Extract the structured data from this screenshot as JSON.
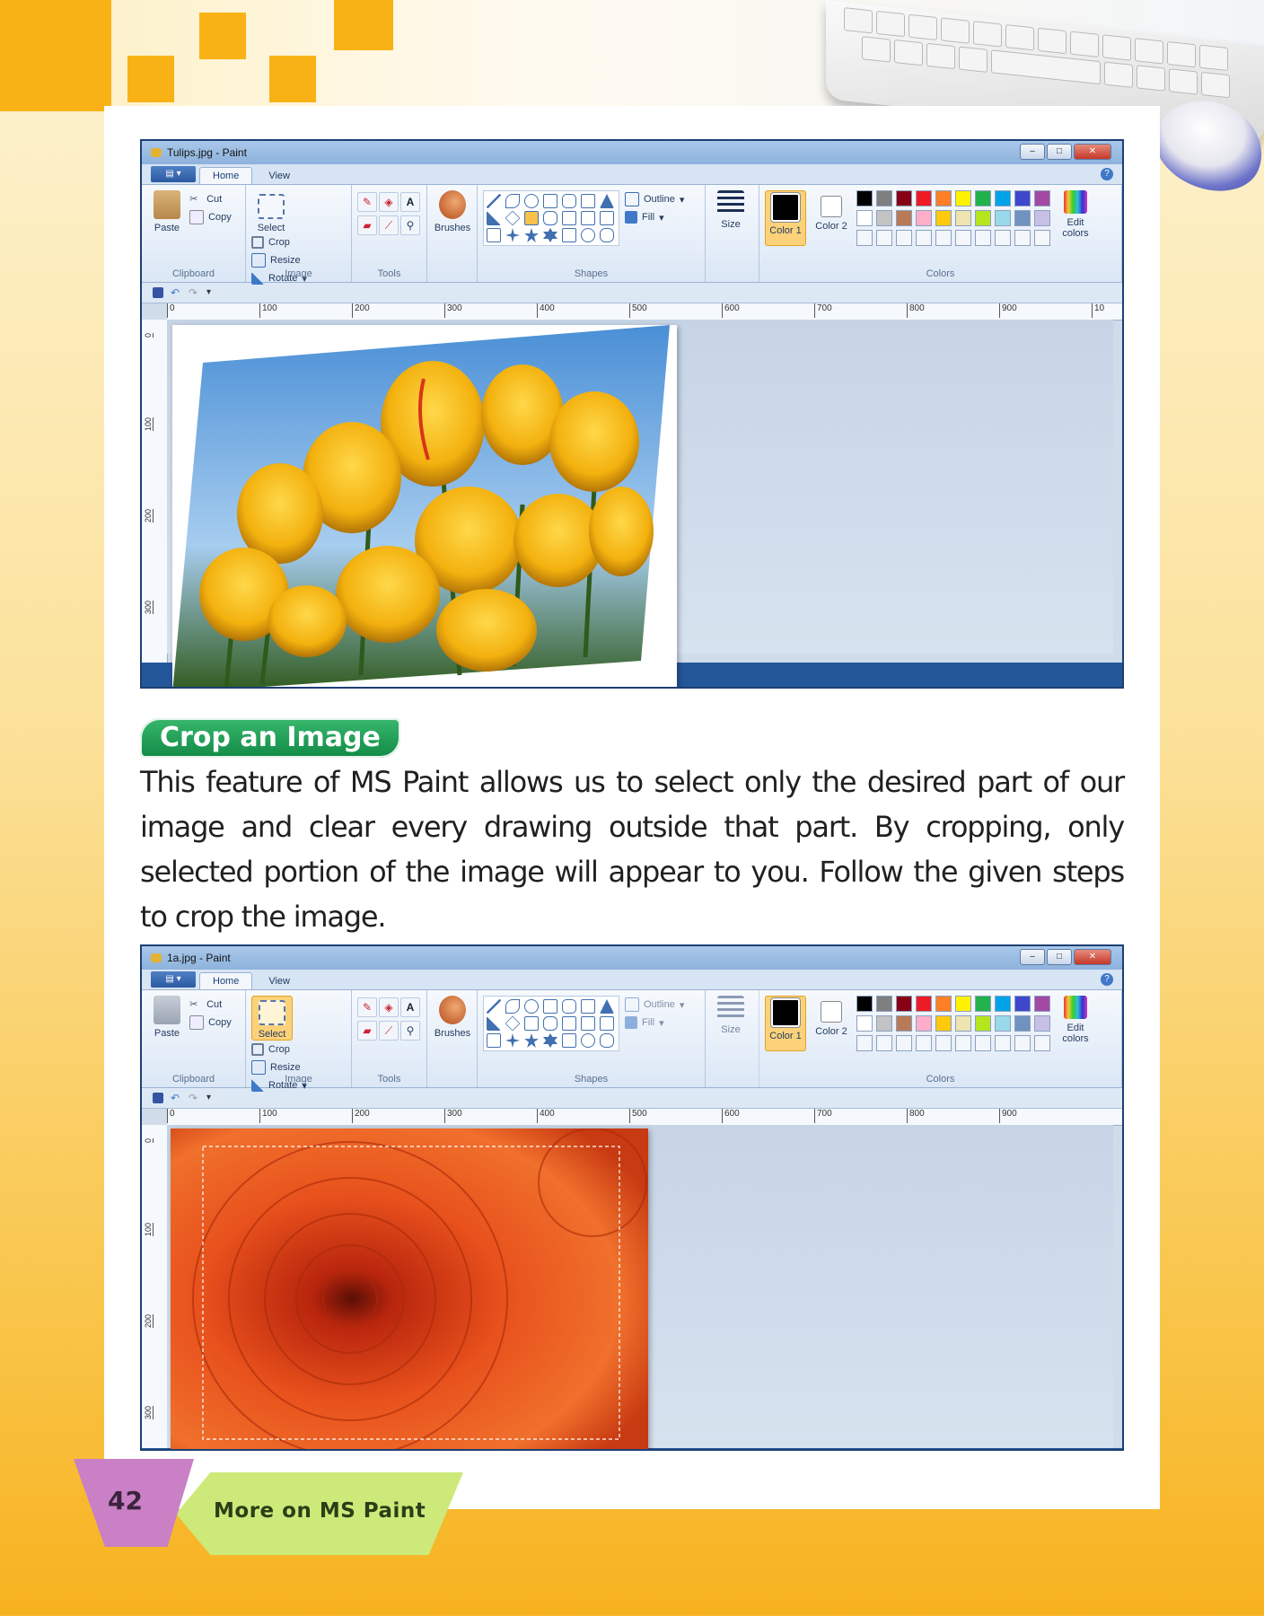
{
  "window1": {
    "title": "Tulips.jpg - Paint",
    "tabs": [
      "Home",
      "View"
    ],
    "active_tab": "Home",
    "groups": {
      "clipboard": {
        "label": "Clipboard",
        "paste": "Paste",
        "cut": "Cut",
        "copy": "Copy"
      },
      "image": {
        "label": "Image",
        "select": "Select",
        "crop": "Crop",
        "resize": "Resize",
        "rotate": "Rotate"
      },
      "tools": {
        "label": "Tools"
      },
      "brushes": {
        "label": "Brushes"
      },
      "shapes": {
        "label": "Shapes",
        "outline": "Outline",
        "fill": "Fill"
      },
      "size": {
        "label": "Size"
      },
      "colors": {
        "label": "Colors",
        "color1": "Color 1",
        "color2": "Color 2",
        "edit": "Edit colors"
      }
    },
    "ruler_h": [
      "0",
      "100",
      "200",
      "300",
      "400",
      "500",
      "600",
      "700",
      "800",
      "900",
      "10"
    ],
    "ruler_v": [
      "0",
      "100",
      "200",
      "300",
      "400"
    ],
    "image_subject": "yellow-tulips-photo"
  },
  "window2": {
    "title": "1a.jpg - Paint",
    "tabs": [
      "Home",
      "View"
    ],
    "active_tab": "Home",
    "groups": {
      "clipboard": {
        "label": "Clipboard",
        "paste": "Paste",
        "cut": "Cut",
        "copy": "Copy"
      },
      "image": {
        "label": "Image",
        "select": "Select",
        "crop": "Crop",
        "resize": "Resize",
        "rotate": "Rotate"
      },
      "tools": {
        "label": "Tools"
      },
      "brushes": {
        "label": "Brushes"
      },
      "shapes": {
        "label": "Shapes",
        "outline": "Outline",
        "fill": "Fill"
      },
      "size": {
        "label": "Size"
      },
      "colors": {
        "label": "Colors",
        "color1": "Color 1",
        "color2": "Color 2",
        "edit": "Edit colors"
      }
    },
    "ruler_h": [
      "0",
      "100",
      "200",
      "300",
      "400",
      "500",
      "600",
      "700",
      "800",
      "900"
    ],
    "ruler_v": [
      "0",
      "100",
      "200",
      "300"
    ],
    "image_subject": "orange-chrysanthemum-photo"
  },
  "palette": [
    "#000000",
    "#7f7f7f",
    "#880015",
    "#ed1c24",
    "#ff7f27",
    "#fff200",
    "#22b14c",
    "#00a2e8",
    "#3f48cc",
    "#a349a4",
    "#ffffff",
    "#c3c3c3",
    "#b97a57",
    "#ffaec9",
    "#ffc90e",
    "#efe4b0",
    "#b5e61d",
    "#99d9ea",
    "#7092be",
    "#c8bfe7"
  ],
  "section": {
    "heading": "Crop an Image",
    "paragraph": "This feature of MS Paint allows us to select only the desired part of our image and clear every drawing outside that part. By cropping, only selected portion of the image will appear to you. Follow the given steps to crop the image."
  },
  "footer": {
    "page_number": "42",
    "chapter_title": "More on MS Paint"
  },
  "colors": {
    "accent_orange": "#f9b215",
    "heading_green": "#1f9a55",
    "footer_purple": "#c980c5",
    "footer_green": "#cde97a"
  }
}
